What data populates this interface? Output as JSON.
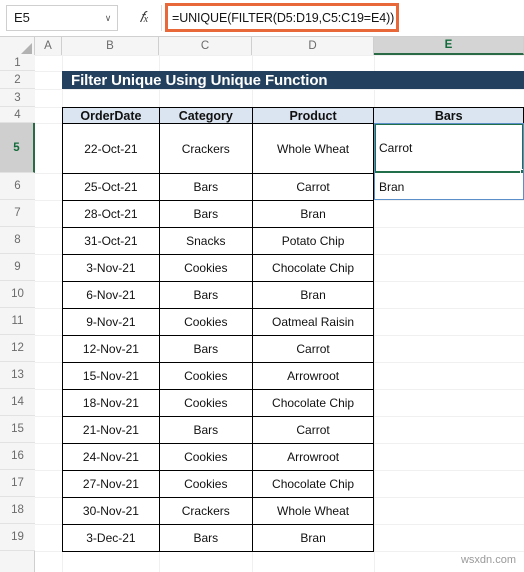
{
  "formula_bar": {
    "name_box_value": "E5",
    "name_box_caret": "∨",
    "fx_label": "fx",
    "formula": "=UNIQUE(FILTER(D5:D19,C5:C19=E4))",
    "highlight_color": "#E8683A"
  },
  "grid": {
    "column_headers": [
      "A",
      "B",
      "C",
      "D",
      "E"
    ],
    "selected_column": "E",
    "row_headers": [
      "1",
      "2",
      "3",
      "4",
      "5",
      "6",
      "7",
      "8",
      "9",
      "10",
      "11",
      "12",
      "13",
      "14",
      "15",
      "16",
      "17",
      "18",
      "19"
    ],
    "selected_row": "5"
  },
  "title_banner": {
    "text": "Filter Unique Using Unique Function",
    "background": "#23405F",
    "text_color": "#FFFFFF"
  },
  "table": {
    "header_background": "#DBE5F1",
    "columns": [
      "OrderDate",
      "Category",
      "Product",
      "Bars"
    ],
    "rows": [
      {
        "order_date": "22-Oct-21",
        "category": "Crackers",
        "product": "Whole Wheat"
      },
      {
        "order_date": "25-Oct-21",
        "category": "Bars",
        "product": "Carrot"
      },
      {
        "order_date": "28-Oct-21",
        "category": "Bars",
        "product": "Bran"
      },
      {
        "order_date": "31-Oct-21",
        "category": "Snacks",
        "product": "Potato Chip"
      },
      {
        "order_date": "3-Nov-21",
        "category": "Cookies",
        "product": "Chocolate Chip"
      },
      {
        "order_date": "6-Nov-21",
        "category": "Bars",
        "product": "Bran"
      },
      {
        "order_date": "9-Nov-21",
        "category": "Cookies",
        "product": "Oatmeal Raisin"
      },
      {
        "order_date": "12-Nov-21",
        "category": "Bars",
        "product": "Carrot"
      },
      {
        "order_date": "15-Nov-21",
        "category": "Cookies",
        "product": "Arrowroot"
      },
      {
        "order_date": "18-Nov-21",
        "category": "Cookies",
        "product": "Chocolate Chip"
      },
      {
        "order_date": "21-Nov-21",
        "category": "Bars",
        "product": "Carrot"
      },
      {
        "order_date": "24-Nov-21",
        "category": "Cookies",
        "product": "Arrowroot"
      },
      {
        "order_date": "27-Nov-21",
        "category": "Cookies",
        "product": "Chocolate Chip"
      },
      {
        "order_date": "30-Nov-21",
        "category": "Crackers",
        "product": "Whole Wheat"
      },
      {
        "order_date": "3-Dec-21",
        "category": "Bars",
        "product": "Bran"
      }
    ]
  },
  "spill_results": {
    "cells": [
      "Carrot",
      "Bran"
    ],
    "selection_border_color": "#21704B",
    "spill_border_color": "#5B8FC9"
  },
  "watermark": {
    "text": "wsxdn.com"
  }
}
